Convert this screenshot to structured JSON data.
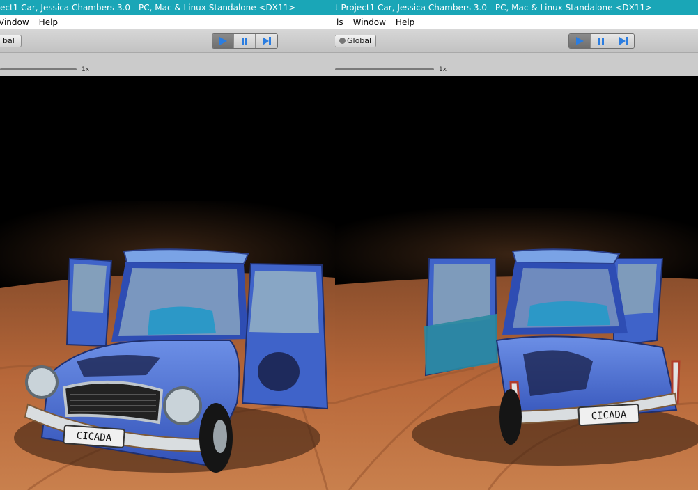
{
  "left": {
    "title": "ect1 Car, Jessica Chambers 3.0 - PC, Mac & Linux Standalone <DX11>",
    "menu": [
      "Vindow",
      "Help"
    ],
    "global_label": "bal",
    "zoom_label": "1x",
    "plate_text": "CICADA"
  },
  "right": {
    "title": "t Project1 Car, Jessica Chambers 3.0 - PC, Mac & Linux Standalone <DX11>",
    "menu": [
      "ls",
      "Window",
      "Help"
    ],
    "global_label": "Global",
    "zoom_label": "1x",
    "plate_text": "CICADA"
  },
  "controls": {
    "play_icon": "play-icon",
    "pause_icon": "pause-icon",
    "step_icon": "step-icon"
  },
  "colors": {
    "titlebar": "#1aa6b7",
    "car_blue": "#3f63c9",
    "ground": "#b8683a",
    "play_active": "#2b7de0"
  }
}
